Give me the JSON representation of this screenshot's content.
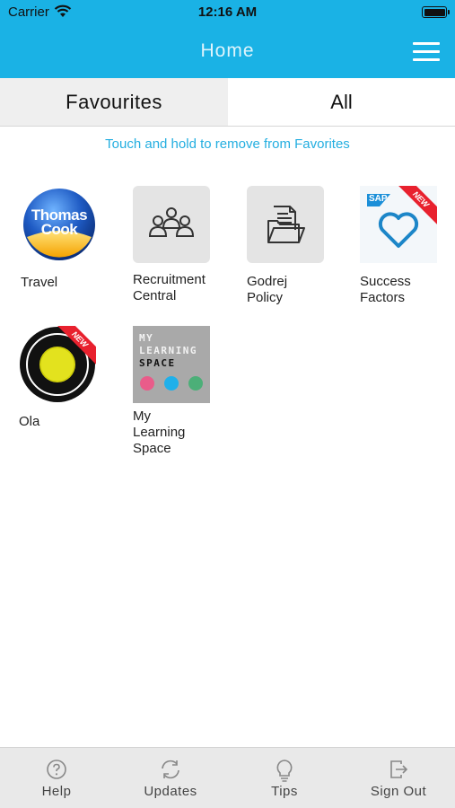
{
  "status_bar": {
    "carrier": "Carrier",
    "time": "12:16 AM"
  },
  "nav": {
    "title": "Home"
  },
  "tabs": [
    {
      "label": "Favourites",
      "selected": true
    },
    {
      "label": "All",
      "selected": false
    }
  ],
  "hint": "Touch and hold to remove from Favorites",
  "apps": [
    {
      "label": "Travel",
      "logo_line1": "Thomas",
      "logo_line2": "Cook",
      "badge": ""
    },
    {
      "label": "Recruitment\nCentral",
      "badge": ""
    },
    {
      "label": "Godrej\nPolicy",
      "badge": ""
    },
    {
      "label": "Success\nFactors",
      "logo_text": "SAP",
      "badge": "NEW"
    },
    {
      "label": "Ola",
      "badge": "NEW"
    },
    {
      "label": "My\nLearning\nSpace",
      "logo_line1": "MY",
      "logo_line2": "LEARNING",
      "logo_line3": "SPACE",
      "badge": ""
    }
  ],
  "bottom_bar": [
    {
      "label": "Help",
      "icon": "help-icon"
    },
    {
      "label": "Updates",
      "icon": "refresh-icon"
    },
    {
      "label": "Tips",
      "icon": "lightbulb-icon"
    },
    {
      "label": "Sign Out",
      "icon": "sign-out-icon"
    }
  ],
  "colors": {
    "header": "#1ab2e5",
    "hint_text": "#23aee0",
    "badge_red": "#e8212e",
    "tabbar_bg": "#e9e9e9"
  }
}
